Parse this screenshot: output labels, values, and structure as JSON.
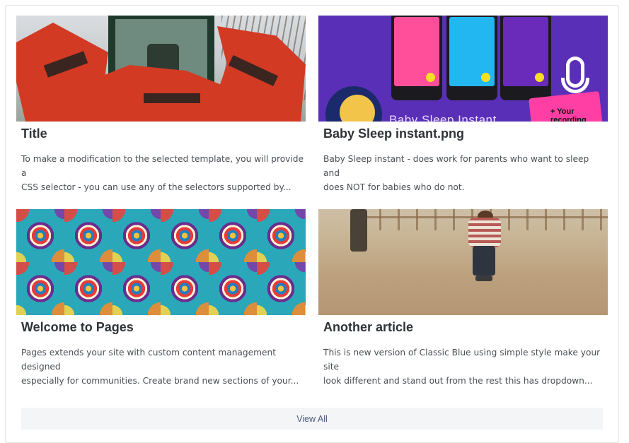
{
  "articles": [
    {
      "title": "Title",
      "excerpt_line1": "To make a modification to the selected template, you will provide a",
      "excerpt_line2": "CSS selector - you can use any of the selectors supported by...",
      "image_desc": "red-farm-machine"
    },
    {
      "title": "Baby Sleep instant.png",
      "excerpt_line1": "Baby Sleep instant - does work for parents who want to sleep and",
      "excerpt_line2": "does NOT for babies who do not.",
      "image_desc": "baby-sleep-app",
      "image_banner": "Baby Sleep Instant",
      "image_badge": "+ Your recording"
    },
    {
      "title": "Welcome to Pages",
      "excerpt_line1": "Pages extends your site with custom content management designed",
      "excerpt_line2": "especially for communities. Create brand new sections of your...",
      "image_desc": "mandala-pattern"
    },
    {
      "title": "Another article",
      "excerpt_line1": "This is new version of Classic Blue using simple style make your site",
      "excerpt_line2": "look different and stand out from the rest this has dropdown...",
      "image_desc": "child-in-desert"
    }
  ],
  "view_all_label": "View All"
}
